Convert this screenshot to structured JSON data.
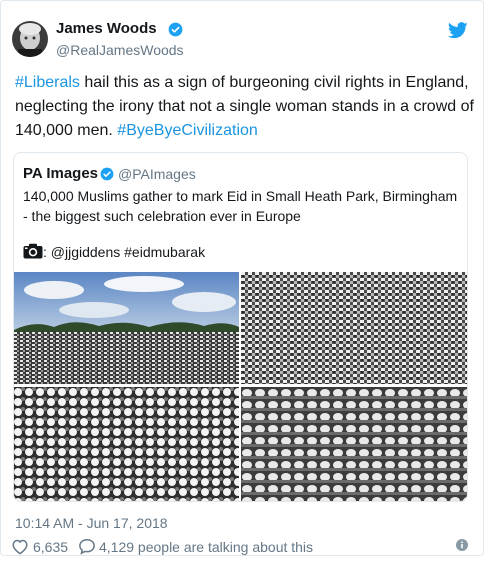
{
  "author": {
    "name": "James Woods",
    "handle": "@RealJamesWoods",
    "avatar_icon": "avatar-photo",
    "verified_icon": "verified-badge-icon"
  },
  "platform_icon": "twitter-bird-icon",
  "tweet": {
    "hashtag1": "#Liberals",
    "text": " hail this as a sign of burgeoning civil rights in England, neglecting the irony that not a single woman stands in a crowd of 140,000 men. ",
    "hashtag2": "#ByeByeCivilization"
  },
  "quoted": {
    "name": "PA Images",
    "handle": "@PAImages",
    "text": "140,000 Muslims gather to mark Eid in Small Heath Park, Birmingham - the biggest such celebration ever in Europe",
    "camera_icon": "camera-icon",
    "credit": ": @jjgiddens #eidmubarak",
    "photos": [
      "crowd-park-wide-photo",
      "crowd-rows-photo",
      "kneeling-rows-photo",
      "prostrating-rows-photo"
    ]
  },
  "timestamp": "10:14 AM - Jun 17, 2018",
  "stats": {
    "likes": "6,635",
    "talking": "4,129 people are talking about this"
  },
  "colors": {
    "link": "#1b95e0",
    "muted": "#657786",
    "border": "#e1e8ed",
    "heart": "#657786"
  }
}
